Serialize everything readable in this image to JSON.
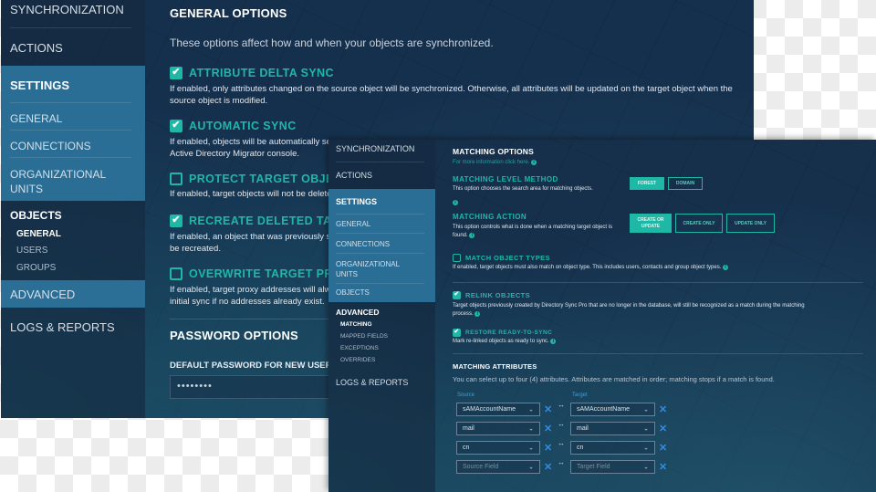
{
  "window_back": {
    "sidebar": {
      "top_items": [
        "SYNCHRONIZATION",
        "ACTIONS"
      ],
      "settings_label": "SETTINGS",
      "settings_items": [
        "GENERAL",
        "CONNECTIONS",
        "ORGANIZATIONAL UNITS"
      ],
      "objects_label": "OBJECTS",
      "objects_items": [
        "GENERAL",
        "USERS",
        "GROUPS"
      ],
      "advanced_label": "ADVANCED",
      "logs_label": "LOGS & REPORTS"
    },
    "main": {
      "title": "GENERAL OPTIONS",
      "intro": "These options affect how and when your objects are synchronized.",
      "options": [
        {
          "title": "ATTRIBUTE DELTA SYNC",
          "checked": true,
          "desc1": "If enabled, only attributes changed on the source object will be synchronized. Otherwise, all attributes will be updated on the target object when the",
          "desc2": "source object is modified."
        },
        {
          "title": "AUTOMATIC SYNC",
          "checked": true,
          "desc1": "If enabled, objects will be automatically se",
          "desc2": "Active Directory Migrator console."
        },
        {
          "title": "PROTECT TARGET OBJEC",
          "checked": false,
          "desc1": "If enabled, target objects will not be delete",
          "desc2": ""
        },
        {
          "title": "RECREATE DELETED TAR",
          "checked": true,
          "desc1": "If enabled, an object that was previously s",
          "desc2": "be recreated."
        },
        {
          "title": "OVERWRITE TARGET PRO",
          "checked": false,
          "desc1": "If enabled, target proxy addresses will alw",
          "desc2": "initial sync if no addresses already exist."
        }
      ],
      "password_title": "PASSWORD OPTIONS",
      "password_label": "DEFAULT PASSWORD FOR NEW USERS",
      "password_value": "••••••••"
    }
  },
  "window_front": {
    "sidebar": {
      "top_items": [
        "SYNCHRONIZATION",
        "ACTIONS"
      ],
      "settings_label": "SETTINGS",
      "settings_items": [
        "GENERAL",
        "CONNECTIONS",
        "ORGANIZATIONAL UNITS",
        "OBJECTS"
      ],
      "advanced_label": "ADVANCED",
      "advanced_items": [
        "MATCHING",
        "MAPPED FIELDS",
        "EXCEPTIONS",
        "OVERRIDES"
      ],
      "logs_label": "LOGS & REPORTS"
    },
    "main": {
      "title": "MATCHING OPTIONS",
      "more_info": "For more information click here.",
      "level_method": {
        "title": "MATCHING LEVEL METHOD",
        "desc": "This option chooses the search area for matching objects.",
        "options": [
          "FOREST",
          "DOMAIN"
        ],
        "selected": "FOREST"
      },
      "action": {
        "title": "MATCHING ACTION",
        "desc": "This option controls what is done when a matching target object is found.",
        "options": [
          "CREATE OR UPDATE",
          "CREATE ONLY",
          "UPDATE ONLY"
        ],
        "selected": "CREATE OR UPDATE"
      },
      "match_object_types": {
        "title": "MATCH OBJECT TYPES",
        "checked": false,
        "desc": "If enabled, target objects must also match on object type. This includes users, contacts and group object types."
      },
      "relink_objects": {
        "title": "RELINK OBJECTS",
        "checked": true,
        "desc1": "Target objects previously created by Directory Sync Pro that are no longer in the database, will still be recognized as a match during the matching",
        "desc2": "process."
      },
      "restore_ready": {
        "title": "RESTORE READY-TO-SYNC",
        "checked": true,
        "desc": "Mark re-linked objects as ready to sync."
      },
      "attributes": {
        "title": "MATCHING ATTRIBUTES",
        "desc": "You can select up to four (4) attributes. Attributes are matched in order; matching stops if a match is found.",
        "source_label": "Source",
        "target_label": "Target",
        "rows": [
          {
            "source": "sAMAccountName",
            "target": "sAMAccountName"
          },
          {
            "source": "mail",
            "target": "mail"
          },
          {
            "source": "cn",
            "target": "cn"
          },
          {
            "source": "Source Field",
            "target": "Target Field",
            "placeholder": true
          }
        ]
      }
    }
  },
  "colors": {
    "accent": "#1fb7a6",
    "panel": "#15304d",
    "sidebar_active": "#2a6d95",
    "remove_icon": "#2f8ee0"
  }
}
